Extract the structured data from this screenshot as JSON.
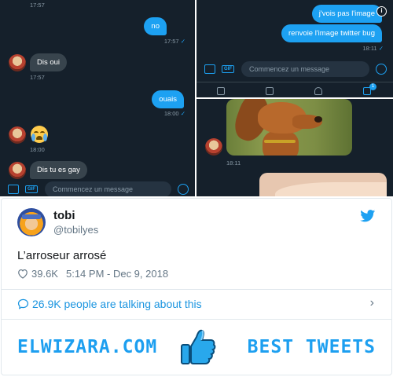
{
  "chat": {
    "left": {
      "messages": [
        {
          "ts": "17:57"
        },
        {
          "out": "no",
          "ts": "17:57"
        },
        {
          "in": "Dis oui",
          "ts": "17:57"
        },
        {
          "out": "ouais",
          "ts": "18:00"
        },
        {
          "emoji": "loudly-crying-face",
          "ts": "18:00"
        },
        {
          "in": "Dis tu es gay"
        }
      ],
      "composer_placeholder": "Commencez un message"
    },
    "top_right": {
      "messages": [
        {
          "out": "j'vois pas l'image"
        },
        {
          "out": "renvoie l'image twitter bug",
          "ts": "18:11"
        }
      ],
      "composer_placeholder": "Commencez un message",
      "badge_count": "1"
    },
    "bottom_right": {
      "ts": "18:11"
    }
  },
  "tweet": {
    "display_name": "tobi",
    "handle": "@tobilyes",
    "text": "L’arroseur arrosé",
    "likes": "39.6K",
    "timestamp": "5:14 PM - Dec 9, 2018",
    "conversation": "26.9K people are talking about this"
  },
  "banner": {
    "left": "ELWIZARA.COM",
    "right": "BEST TWEETS"
  },
  "colors": {
    "twitter_blue": "#1da1f2",
    "dark_bg": "#15202b",
    "banner_blue": "#1d9ff0"
  }
}
